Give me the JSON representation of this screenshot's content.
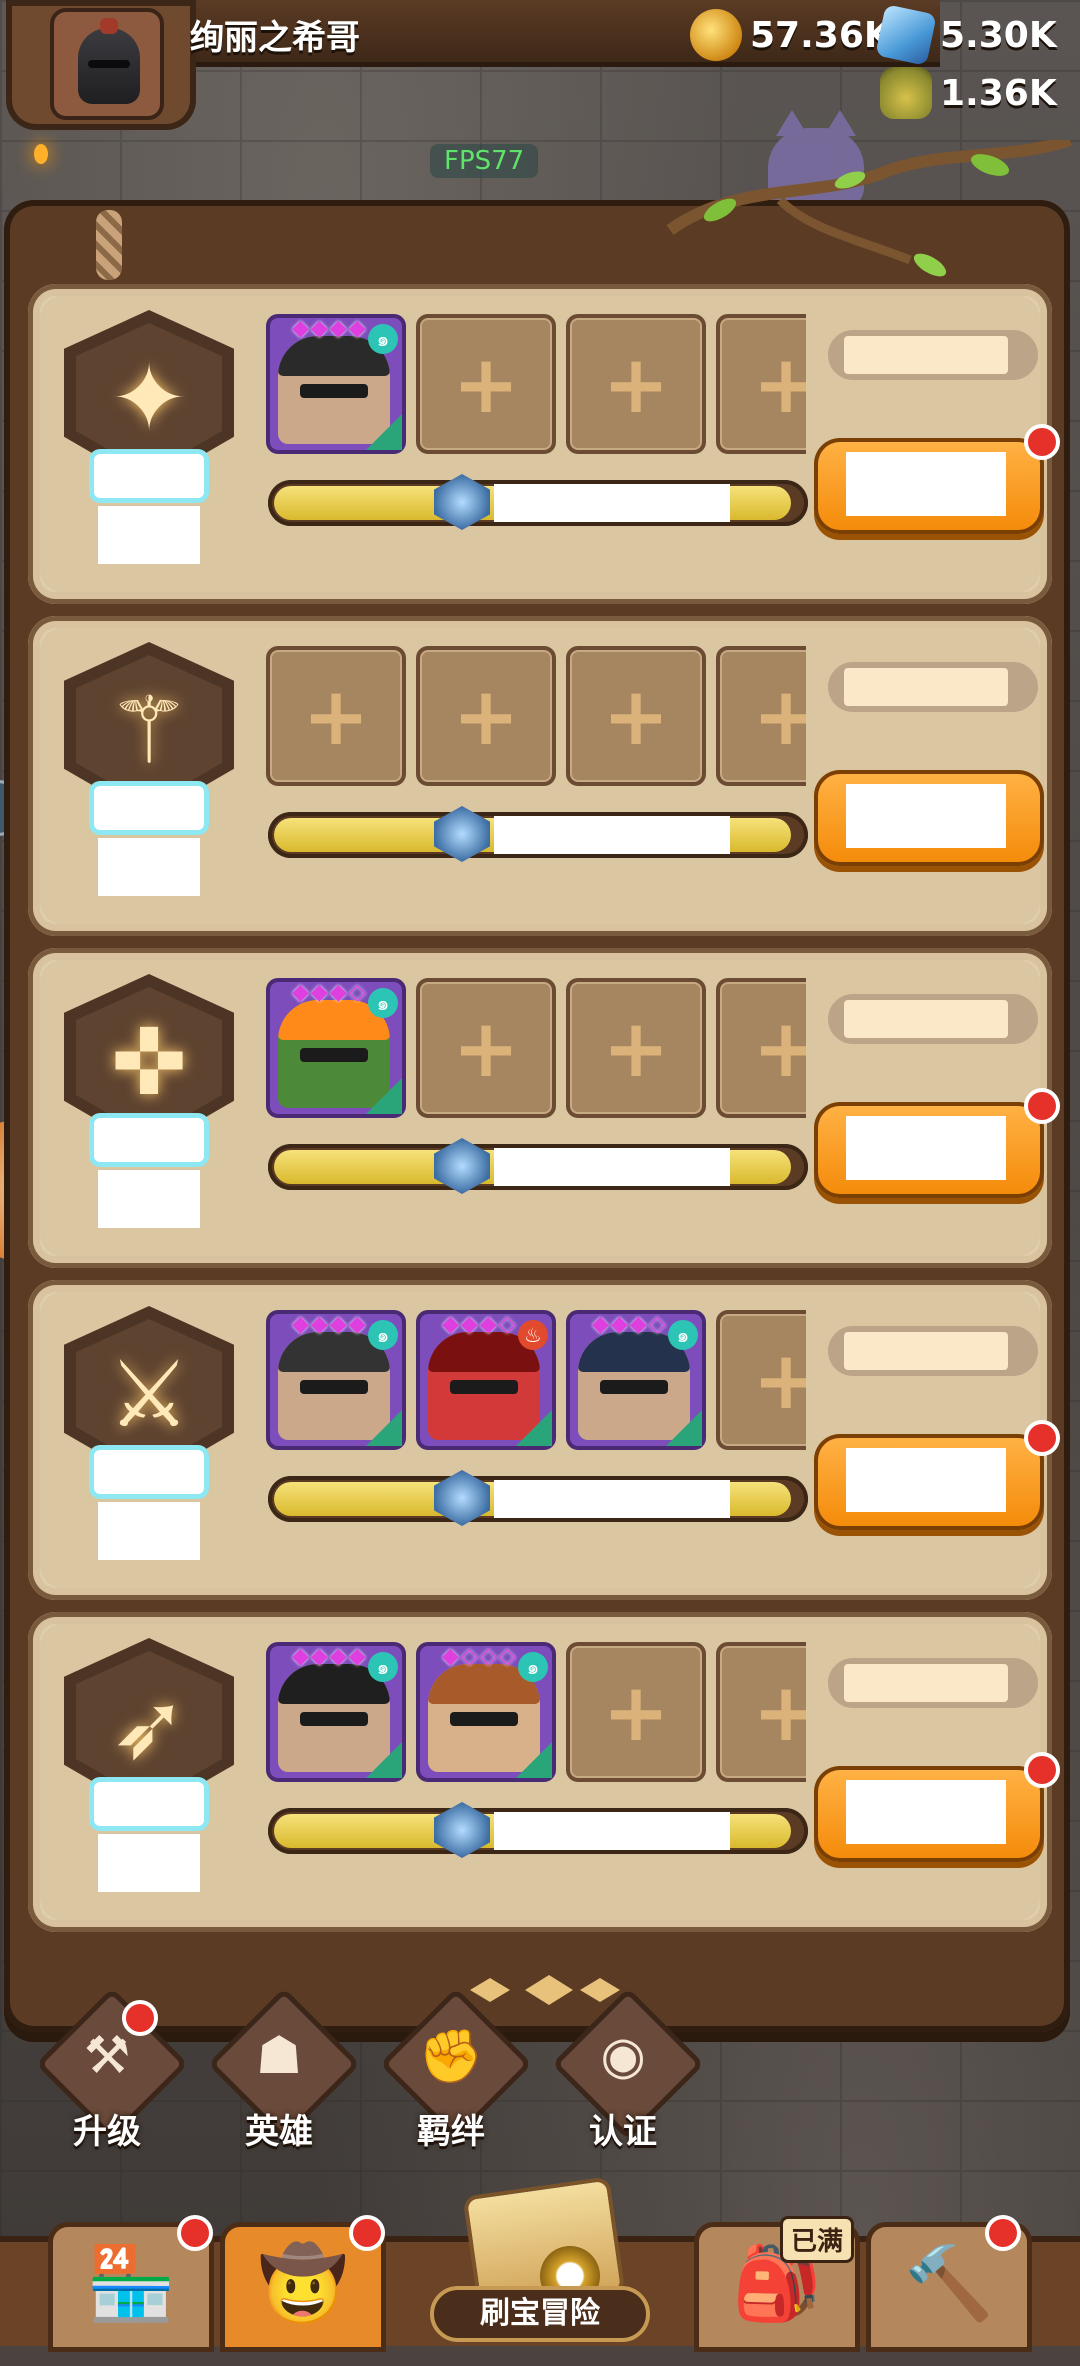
{
  "player": {
    "name": "绚丽之希哥"
  },
  "currencies": {
    "gold": "57.36K",
    "gems": "5.30K",
    "potion": "1.36K"
  },
  "fps": "FPS77",
  "classes": [
    {
      "icon": "shield-icon",
      "glyph": "✦",
      "slots": [
        {
          "type": "hero",
          "stars": "◆◆◆◆",
          "hair": "#2a2a2a",
          "skin": "#caa889",
          "element": "wind"
        },
        {
          "type": "empty"
        },
        {
          "type": "empty"
        },
        {
          "type": "empty"
        }
      ],
      "progress": 0.98,
      "has_badge": true
    },
    {
      "icon": "staff-icon",
      "glyph": "⚚",
      "slots": [
        {
          "type": "empty"
        },
        {
          "type": "empty"
        },
        {
          "type": "empty"
        },
        {
          "type": "empty"
        }
      ],
      "progress": 0.98,
      "has_badge": false
    },
    {
      "icon": "crossbow-icon",
      "glyph": "✜",
      "slots": [
        {
          "type": "hero",
          "stars": "◆◆◆◇",
          "hair": "#ff8a1a",
          "skin": "#4c8a3a",
          "element": "wind"
        },
        {
          "type": "empty"
        },
        {
          "type": "empty"
        },
        {
          "type": "empty"
        }
      ],
      "progress": 0.98,
      "has_badge": true
    },
    {
      "icon": "sword-icon",
      "glyph": "⚔",
      "slots": [
        {
          "type": "hero",
          "stars": "◆◆◆◆",
          "hair": "#333",
          "skin": "#caa889",
          "element": "wind"
        },
        {
          "type": "hero",
          "stars": "◆◆◆◇",
          "hair": "#7a1010",
          "skin": "#d23a3a",
          "element": "fire"
        },
        {
          "type": "hero",
          "stars": "◆◆◆◇",
          "hair": "#24324e",
          "skin": "#caa889",
          "element": "wind"
        },
        {
          "type": "empty"
        }
      ],
      "progress": 0.98,
      "has_badge": true
    },
    {
      "icon": "bow-icon",
      "glyph": "➶",
      "slots": [
        {
          "type": "hero",
          "stars": "◆◆◆◆",
          "hair": "#1f1f1f",
          "skin": "#caa889",
          "element": "wind"
        },
        {
          "type": "hero",
          "stars": "◆◇◇◇",
          "hair": "#a85a2a",
          "skin": "#d8b08a",
          "element": "wind"
        },
        {
          "type": "empty"
        },
        {
          "type": "empty"
        }
      ],
      "progress": 0.98,
      "has_badge": true
    }
  ],
  "actions": [
    {
      "label": "升级",
      "icon": "upgrade-icon",
      "glyph": "⚒",
      "badge": true
    },
    {
      "label": "英雄",
      "icon": "hero-icon",
      "glyph": "☗",
      "badge": false
    },
    {
      "label": "羁绊",
      "icon": "bond-icon",
      "glyph": "✊",
      "badge": false
    },
    {
      "label": "认证",
      "icon": "eye-icon",
      "glyph": "◉",
      "badge": false
    }
  ],
  "nav": {
    "shop_icon": "shop-icon",
    "hero_icon": "hero-avatar-icon",
    "adventure_label": "刷宝冒险",
    "full_tag": "已满",
    "chest_icon": "backpack-icon",
    "forge_icon": "hammer-icon"
  }
}
